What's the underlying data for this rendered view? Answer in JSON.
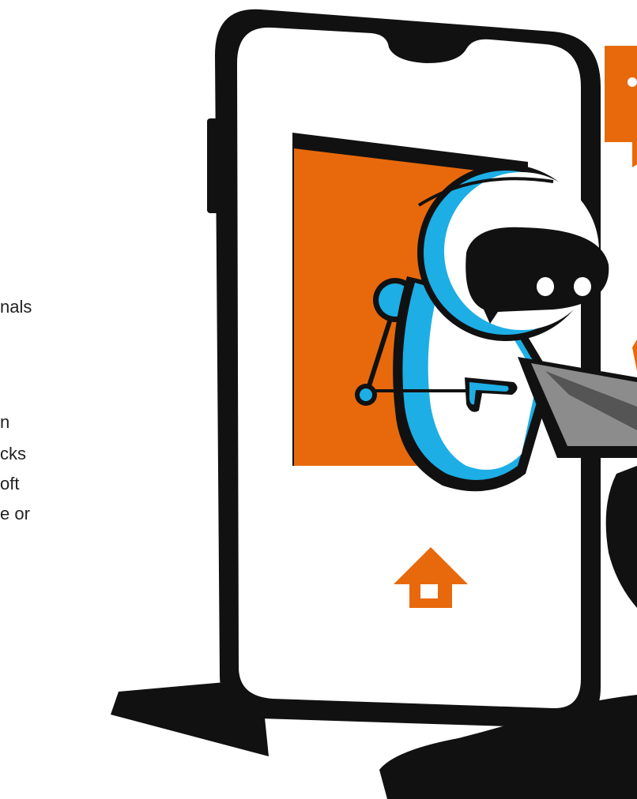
{
  "text_fragments": [
    "nals",
    "n",
    "cks",
    "oft",
    "e or"
  ],
  "colors": {
    "accent_orange": "#E8690B",
    "robot_blue": "#1DAEE5",
    "outline_black": "#111111",
    "screen_white": "#FFFFFF",
    "laptop_gray": "#8C8C8C"
  },
  "icons": [
    "home-icon",
    "chat-bubble-icon"
  ]
}
